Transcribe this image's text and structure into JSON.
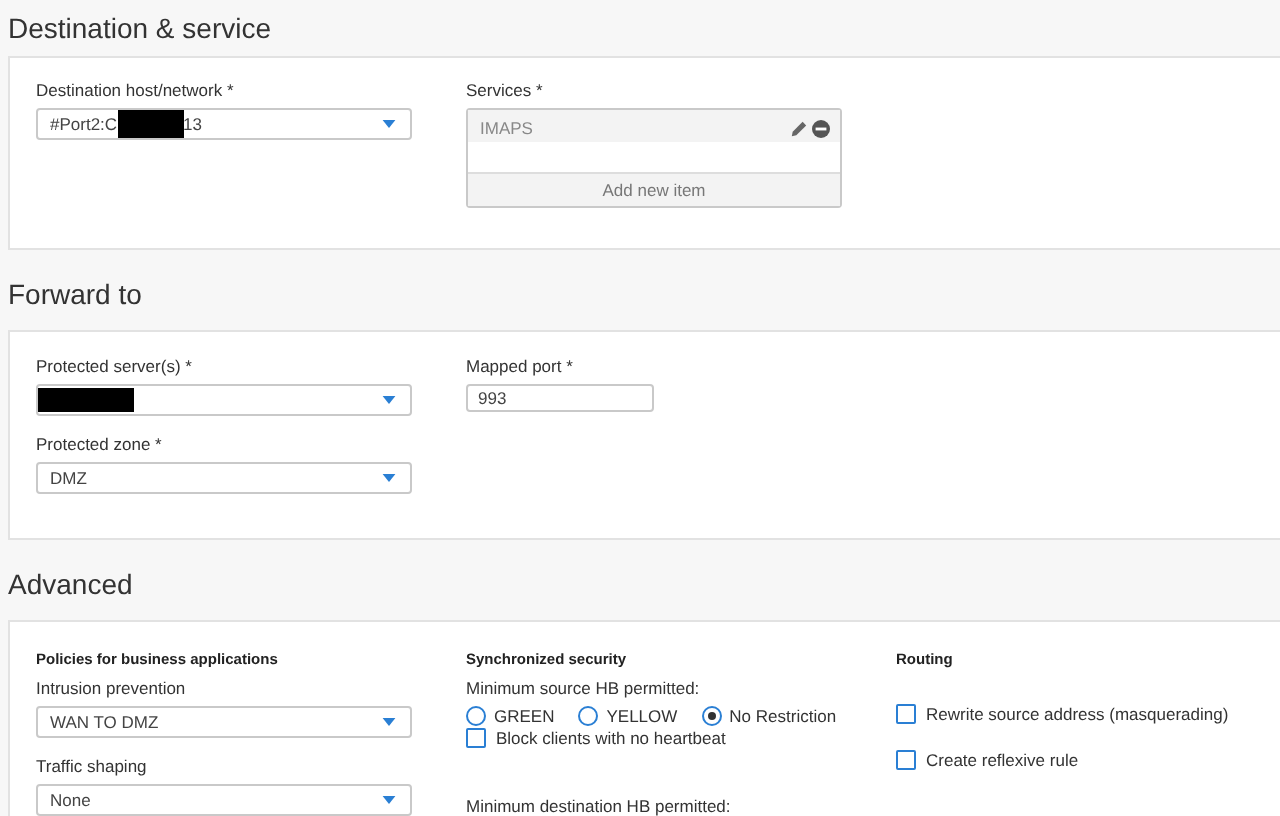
{
  "sections": [
    {
      "title": "Destination & service",
      "columns": [
        [
          {
            "kind": "select",
            "label": "Destination host/network *",
            "value": "#Port2:C",
            "redacted": true,
            "value_after": "13"
          }
        ],
        [
          {
            "kind": "services",
            "label": "Services *",
            "items": [
              {
                "name": "IMAPS"
              }
            ],
            "add_label": "Add new item"
          }
        ],
        []
      ]
    },
    {
      "title": "Forward to",
      "columns": [
        [
          {
            "kind": "select",
            "label": "Protected server(s) *",
            "redacted": true
          },
          {
            "kind": "select",
            "label": "Protected zone *",
            "value": "DMZ"
          }
        ],
        [
          {
            "kind": "text",
            "label": "Mapped port *",
            "value": "993"
          }
        ],
        []
      ]
    },
    {
      "title": "Advanced",
      "columns": [
        [
          {
            "kind": "heading",
            "text": "Policies for business applications"
          },
          {
            "kind": "select",
            "label": "Intrusion prevention",
            "value": "WAN TO DMZ"
          },
          {
            "kind": "select",
            "label": "Traffic shaping",
            "value": "None"
          }
        ],
        [
          {
            "kind": "heading",
            "text": "Synchronized security"
          },
          {
            "kind": "radio_group",
            "label": "Minimum source HB permitted:",
            "options": [
              {
                "label": "GREEN",
                "selected": false
              },
              {
                "label": "YELLOW",
                "selected": false
              },
              {
                "label": "No Restriction",
                "selected": true
              }
            ]
          },
          {
            "kind": "checkbox",
            "label": "Block clients with no heartbeat",
            "checked": false
          },
          {
            "kind": "label",
            "text": "Minimum destination HB permitted:"
          }
        ],
        [
          {
            "kind": "heading",
            "text": "Routing"
          },
          {
            "kind": "checkbox",
            "label": "Rewrite source address (masquerading)",
            "checked": false
          },
          {
            "kind": "checkbox",
            "label": "Create reflexive rule",
            "checked": false
          }
        ]
      ]
    }
  ]
}
